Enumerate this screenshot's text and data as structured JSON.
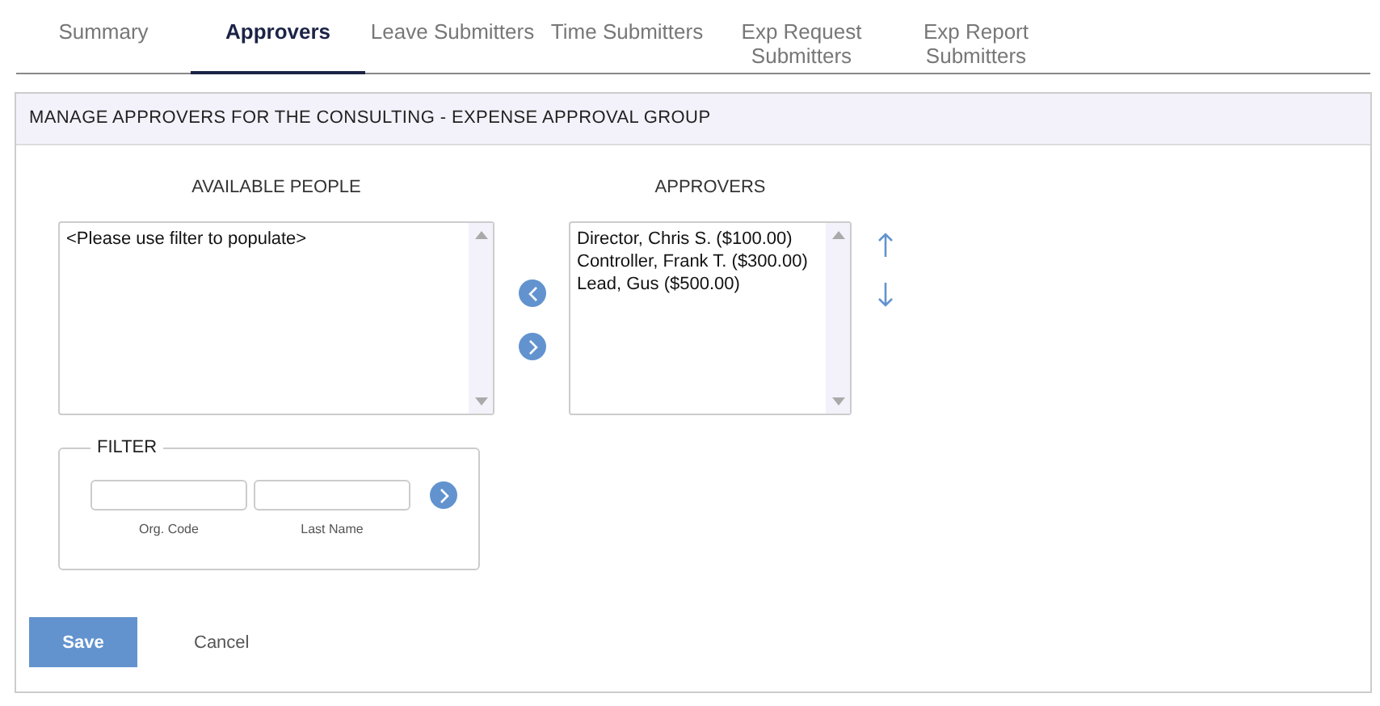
{
  "tabs": [
    {
      "label": "Summary",
      "selected": false
    },
    {
      "label": "Approvers",
      "selected": true
    },
    {
      "label": "Leave Submitters",
      "selected": false
    },
    {
      "label": "Time Submitters",
      "selected": false
    },
    {
      "label": "Exp Request Submitters",
      "selected": false
    },
    {
      "label": "Exp Report Submitters",
      "selected": false
    }
  ],
  "panel": {
    "title": "MANAGE APPROVERS FOR THE CONSULTING - EXPENSE APPROVAL GROUP",
    "available": {
      "label": "AVAILABLE PEOPLE",
      "items": [
        "<Please use filter to populate>"
      ]
    },
    "approvers": {
      "label": "APPROVERS",
      "items": [
        "Director, Chris S. ($100.00)",
        "Controller, Frank T. ($300.00)",
        "Lead, Gus ($500.00)"
      ]
    },
    "filter": {
      "legend": "FILTER",
      "fields": [
        {
          "label": "Org. Code"
        },
        {
          "label": "Last Name"
        }
      ]
    },
    "buttons": [
      {
        "label": "Save",
        "kind": "primary"
      },
      {
        "label": "Cancel",
        "kind": "link"
      }
    ]
  }
}
